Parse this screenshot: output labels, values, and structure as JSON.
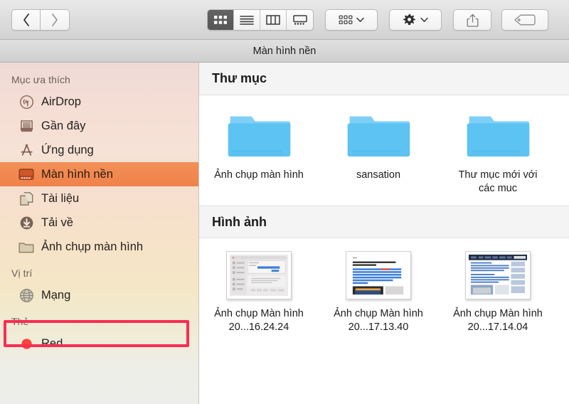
{
  "toolbar": {
    "back_label": "Back",
    "forward_label": "Forward",
    "view_icon_label": "Icon View",
    "view_list_label": "List View",
    "view_column_label": "Column View",
    "view_gallery_label": "Gallery View",
    "arrange_label": "Arrange By",
    "action_label": "Action",
    "share_label": "Share",
    "tag_label": "Tags",
    "selected_view": "icon"
  },
  "window": {
    "title": "Màn hình nền"
  },
  "sidebar": {
    "groups": [
      {
        "header": "Mục ưa thích",
        "items": [
          {
            "label": "AirDrop",
            "icon": "airdrop-icon",
            "selected": false
          },
          {
            "label": "Gần đây",
            "icon": "recents-icon",
            "selected": false
          },
          {
            "label": "Ứng dụng",
            "icon": "applications-icon",
            "selected": false
          },
          {
            "label": "Màn hình nền",
            "icon": "desktop-icon",
            "selected": true
          },
          {
            "label": "Tài liệu",
            "icon": "documents-icon",
            "selected": false
          },
          {
            "label": "Tải về",
            "icon": "downloads-icon",
            "selected": false
          },
          {
            "label": "Ảnh chụp màn hình",
            "icon": "folder-icon",
            "selected": false,
            "annotated": true
          }
        ]
      },
      {
        "header": "Vị trí",
        "items": [
          {
            "label": "Mạng",
            "icon": "network-icon",
            "selected": false
          }
        ]
      },
      {
        "header": "Thẻ",
        "items": [
          {
            "label": "Red",
            "icon": "tag-dot-icon",
            "selected": false,
            "color": "#F9453E"
          }
        ]
      }
    ]
  },
  "content": {
    "sections": [
      {
        "title": "Thư mục",
        "kind": "folders",
        "items": [
          {
            "name": "Ảnh chụp màn hình"
          },
          {
            "name": "sansation"
          },
          {
            "name": "Thư mục mới với các muc"
          }
        ]
      },
      {
        "title": "Hình ảnh",
        "kind": "images",
        "items": [
          {
            "name": "Ảnh chụp Màn hình 20...16.24.24",
            "preview": "preferences-window"
          },
          {
            "name": "Ảnh chụp Màn hình 20...17.13.40",
            "preview": "article-page"
          },
          {
            "name": "Ảnh chụp Màn hình 20...17.14.04",
            "preview": "website-page"
          }
        ]
      }
    ]
  },
  "colors": {
    "selection": "#EF8249",
    "annotation": "#FA2C53",
    "folder": "#5AC8F5",
    "tag_red": "#F9453E"
  }
}
